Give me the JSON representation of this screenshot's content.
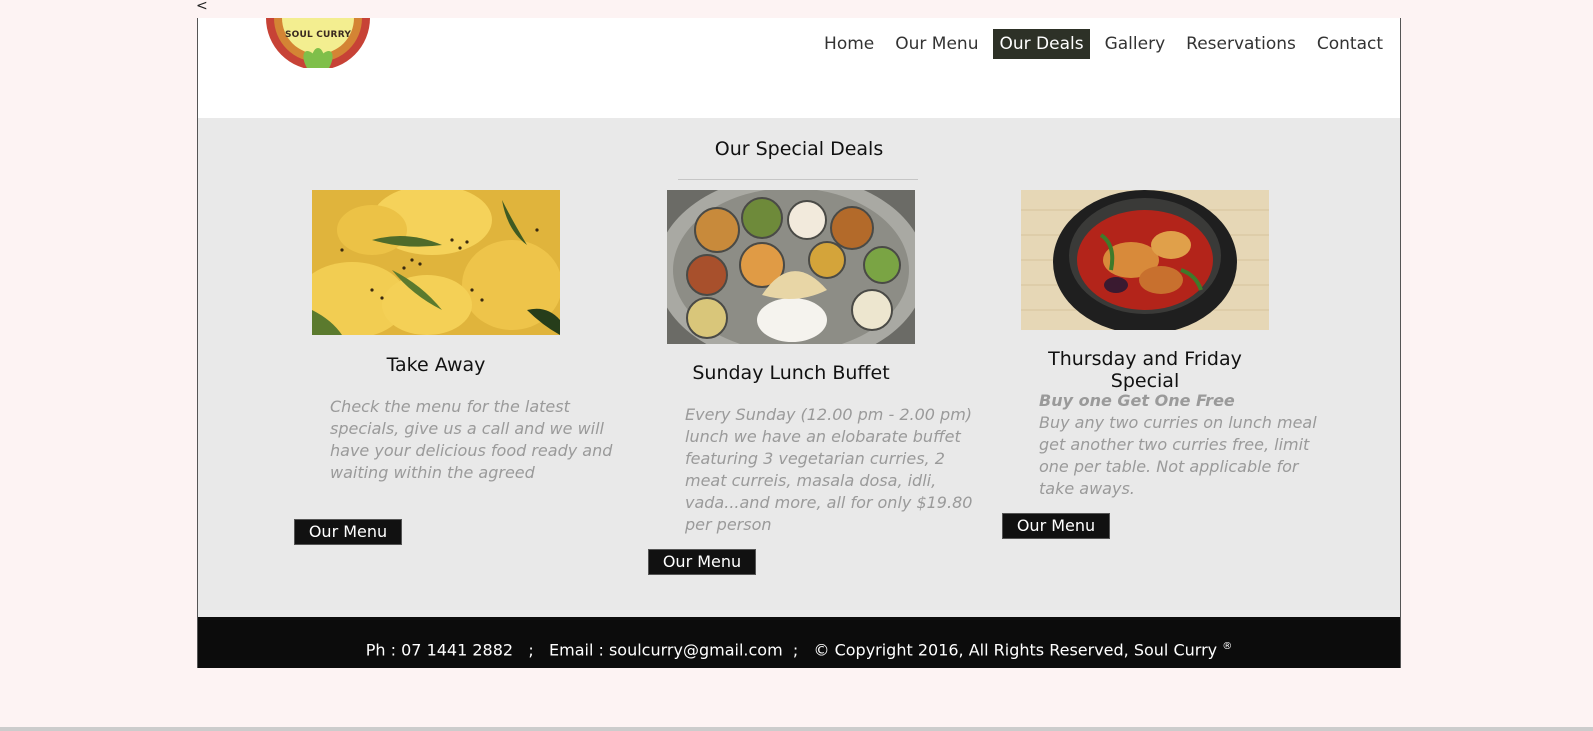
{
  "back": "<",
  "logo": {
    "text": "SOUL CURRY"
  },
  "nav": {
    "items": [
      {
        "label": "Home"
      },
      {
        "label": "Our Menu"
      },
      {
        "label": "Our Deals"
      },
      {
        "label": "Gallery"
      },
      {
        "label": "Reservations"
      },
      {
        "label": "Contact"
      }
    ],
    "active": "Our Deals"
  },
  "deals": {
    "title": "Our Special Deals",
    "cards": [
      {
        "title": "Take Away",
        "text": "Check the menu for the latest specials, give us a call and we will have your delicious food ready and waiting within the agreed",
        "button": "Our Menu",
        "image": "dhokla-photo"
      },
      {
        "title": "Sunday Lunch Buffet",
        "text": "Every Sunday (12.00 pm - 2.00 pm) lunch we have an elobarate buffet featuring 3 vegetarian curries, 2 meat curreis, masala dosa, idli, vada...and more, all for only $19.80 per person",
        "button": "Our Menu",
        "image": "thali-photo"
      },
      {
        "title": "Thursday and Friday Special",
        "highlight": "Buy one Get One Free",
        "text": "Buy any two curries on lunch meal get another two curries free, limit one per table. Not applicable for take aways.",
        "button": "Our Menu",
        "image": "fish-curry-photo"
      }
    ]
  },
  "footer": {
    "phone": "Ph : 07 1441 2882",
    "sep1": ";",
    "email": "Email : soulcurry@gmail.com",
    "sep2": ";",
    "copyright": "© Copyright 2016,  All Rights Reserved,  Soul Curry",
    "reg": "®"
  }
}
